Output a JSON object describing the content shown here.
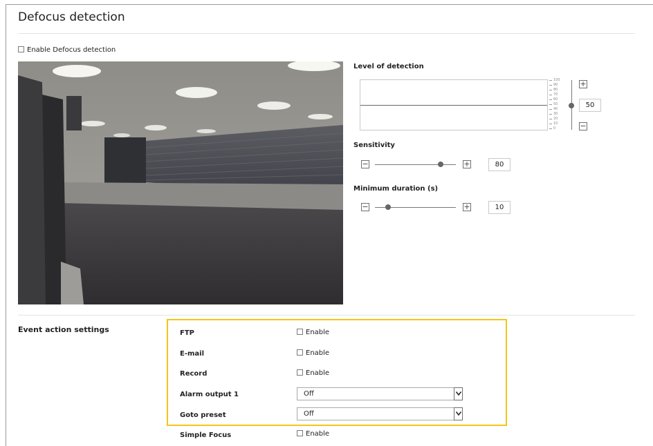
{
  "page": {
    "title": "Defocus detection",
    "enable_label": "Enable Defocus detection"
  },
  "detection": {
    "level_label": "Level of detection",
    "level_value": "50",
    "level_ticks": [
      "100",
      "90",
      "80",
      "70",
      "60",
      "50",
      "40",
      "30",
      "20",
      "10",
      "0"
    ],
    "sensitivity_label": "Sensitivity",
    "sensitivity_value": "80",
    "min_duration_label": "Minimum duration (s)",
    "min_duration_value": "10"
  },
  "events": {
    "section_label": "Event action settings",
    "rows": [
      {
        "label": "FTP",
        "enable_label": "Enable"
      },
      {
        "label": "E-mail",
        "enable_label": "Enable"
      },
      {
        "label": "Record",
        "enable_label": "Enable"
      }
    ],
    "alarm_output_label": "Alarm output 1",
    "alarm_output_value": "Off",
    "goto_preset_label": "Goto preset",
    "goto_preset_value": "Off",
    "simple_focus_label": "Simple Focus",
    "simple_focus_enable": "Enable"
  },
  "colors": {
    "highlight": "#f5c518"
  }
}
